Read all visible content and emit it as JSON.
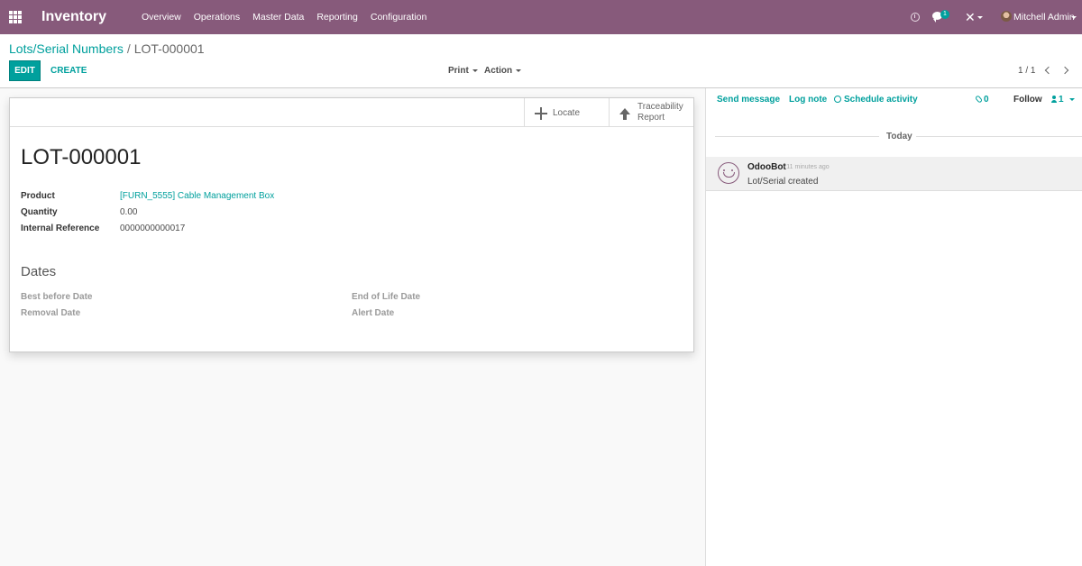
{
  "navbar": {
    "app_name": "Inventory",
    "menu": [
      "Overview",
      "Operations",
      "Master Data",
      "Reporting",
      "Configuration"
    ],
    "chat_count": "1",
    "user_name": "Mitchell Admin"
  },
  "breadcrumb": {
    "parent": "Lots/Serial Numbers",
    "separator": "/",
    "current": "LOT-000001"
  },
  "toolbar": {
    "edit_label": "EDIT",
    "create_label": "CREATE",
    "print_label": "Print",
    "action_label": "Action",
    "pager": "1 / 1"
  },
  "smart_buttons": {
    "locate": "Locate",
    "traceability": "Traceability Report"
  },
  "record": {
    "name": "LOT-000001",
    "fields": [
      {
        "label": "Product",
        "value": "[FURN_5555] Cable Management Box"
      },
      {
        "label": "Quantity",
        "value": "0.00"
      },
      {
        "label": "Internal Reference",
        "value": "0000000000017"
      }
    ],
    "dates_title": "Dates",
    "dates": {
      "best_before": "Best before Date",
      "end_of_life": "End of Life Date",
      "removal": "Removal Date",
      "alert": "Alert Date"
    }
  },
  "chatter": {
    "send_message": "Send message",
    "log_note": "Log note",
    "schedule_activity": "Schedule activity",
    "attachments": "0",
    "follow": "Follow",
    "followers": "1",
    "day_separator": "Today",
    "messages": [
      {
        "author": "OdooBot",
        "time": "- 11 minutes ago",
        "body": "Lot/Serial created"
      }
    ]
  },
  "colors": {
    "brand": "#875a7b",
    "accent": "#00a09d"
  }
}
